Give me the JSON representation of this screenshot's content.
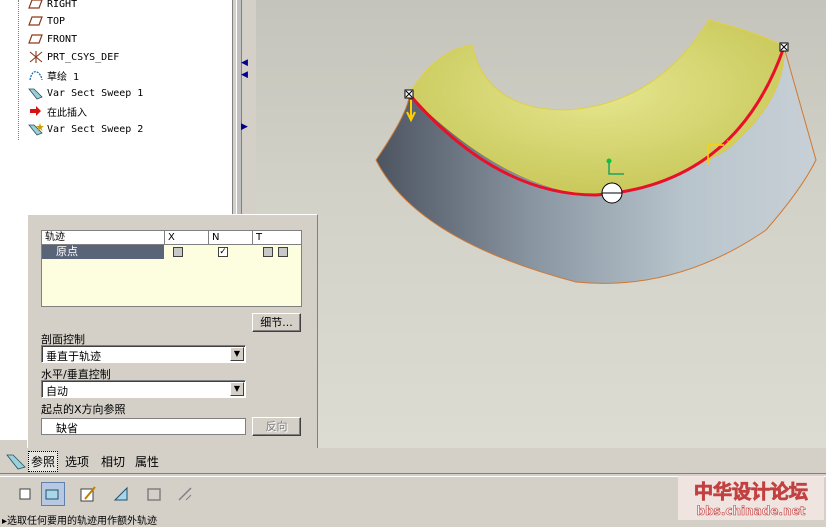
{
  "model_tree": {
    "items": [
      {
        "label": "RIGHT",
        "icon": "datum-plane-icon"
      },
      {
        "label": "TOP",
        "icon": "datum-plane-icon"
      },
      {
        "label": "FRONT",
        "icon": "datum-plane-icon"
      },
      {
        "label": "PRT_CSYS_DEF",
        "icon": "csys-icon"
      },
      {
        "label": "草绘 1",
        "icon": "sketch-icon"
      },
      {
        "label": "Var Sect Sweep 1",
        "icon": "sweep-icon"
      },
      {
        "label": "在此插入",
        "icon": "insert-here-arrow-icon"
      },
      {
        "label": "Var Sect Sweep 2",
        "icon": "sweep-new-icon"
      }
    ]
  },
  "references_panel": {
    "trajectory_table": {
      "headers": [
        "轨迹",
        "X",
        "N",
        "T"
      ],
      "rows": [
        {
          "name": "原点",
          "x": false,
          "n": true,
          "t": false
        }
      ]
    },
    "details_button": "细节...",
    "section_control": {
      "label": "剖面控制",
      "value": "垂直于轨迹"
    },
    "horiz_vert_control": {
      "label": "水平/垂直控制",
      "value": "自动"
    },
    "start_x_ref": {
      "label": "起点的X方向参照",
      "value": "缺省"
    },
    "flip_button": "反向"
  },
  "dashboard_tabs": [
    "参照",
    "选项",
    "相切",
    "属性"
  ],
  "toolbar_icons": [
    "solid-icon",
    "surface-icon",
    "sketch-section-icon",
    "remove-material-icon",
    "thicken-icon",
    "constant-section-icon"
  ],
  "status_text": "▸选取任何要用的轨迹用作额外轨迹",
  "watermark": {
    "line1": "中华设计论坛",
    "line2": "bbs.chinade.net"
  },
  "colors": {
    "accent_red": "#e8102a",
    "surface_yellow": "#dcdc72",
    "selection_blue": "#5a6478"
  }
}
